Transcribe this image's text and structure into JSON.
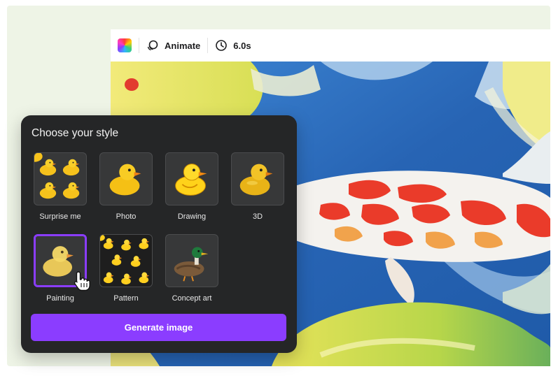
{
  "toolbar": {
    "animate_label": "Animate",
    "duration_label": "6.0s"
  },
  "popup": {
    "title": "Choose your style",
    "styles": [
      {
        "label": "Surprise me",
        "selected": false
      },
      {
        "label": "Photo",
        "selected": false
      },
      {
        "label": "Drawing",
        "selected": false
      },
      {
        "label": "3D",
        "selected": false
      },
      {
        "label": "Painting",
        "selected": true
      },
      {
        "label": "Pattern",
        "selected": false
      },
      {
        "label": "Concept art",
        "selected": false
      }
    ],
    "generate_label": "Generate image"
  },
  "colors": {
    "accent": "#8b3dff",
    "popup_bg": "#252627",
    "water": "#2f6fc0"
  }
}
